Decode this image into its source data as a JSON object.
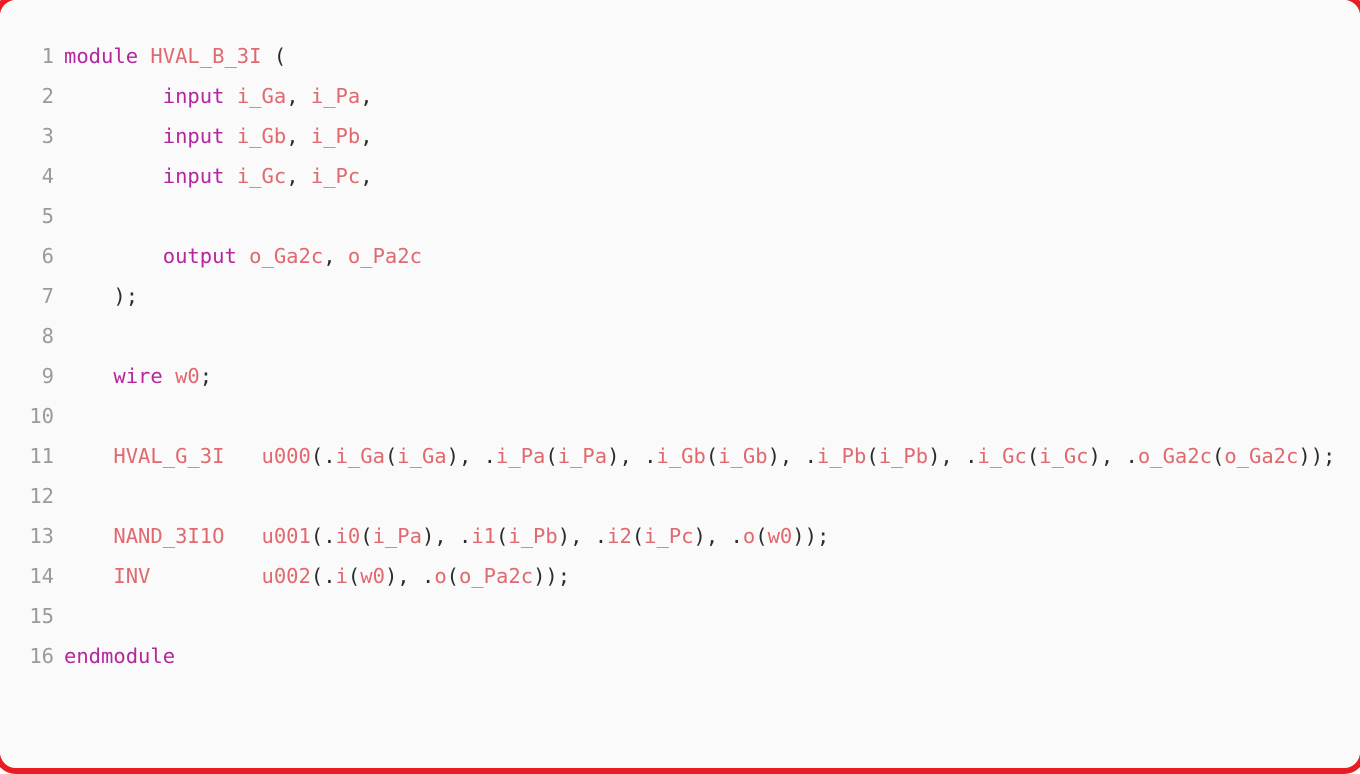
{
  "editor": {
    "language": "verilog",
    "module_name": "HVAL_B_3I",
    "total_lines": 16,
    "colors": {
      "background": "#fafafa",
      "card_border": "#e81c23",
      "line_number": "#9a9a9a",
      "keyword": "#b5269e",
      "identifier": "#e0696f",
      "punctuation": "#2b2b2b"
    }
  },
  "lines": [
    {
      "number": "1",
      "text": "module HVAL_B_3I (",
      "tokens": [
        {
          "t": "module",
          "c": "kw"
        },
        {
          "t": " ",
          "c": "pn"
        },
        {
          "t": "HVAL_B_3I",
          "c": "id"
        },
        {
          "t": " (",
          "c": "pn"
        }
      ]
    },
    {
      "number": "2",
      "text": "        input i_Ga, i_Pa,",
      "tokens": [
        {
          "t": "        ",
          "c": "pn"
        },
        {
          "t": "input",
          "c": "kw"
        },
        {
          "t": " ",
          "c": "pn"
        },
        {
          "t": "i_Ga",
          "c": "id"
        },
        {
          "t": ", ",
          "c": "pn"
        },
        {
          "t": "i_Pa",
          "c": "id"
        },
        {
          "t": ",",
          "c": "pn"
        }
      ]
    },
    {
      "number": "3",
      "text": "        input i_Gb, i_Pb,",
      "tokens": [
        {
          "t": "        ",
          "c": "pn"
        },
        {
          "t": "input",
          "c": "kw"
        },
        {
          "t": " ",
          "c": "pn"
        },
        {
          "t": "i_Gb",
          "c": "id"
        },
        {
          "t": ", ",
          "c": "pn"
        },
        {
          "t": "i_Pb",
          "c": "id"
        },
        {
          "t": ",",
          "c": "pn"
        }
      ]
    },
    {
      "number": "4",
      "text": "        input i_Gc, i_Pc,",
      "tokens": [
        {
          "t": "        ",
          "c": "pn"
        },
        {
          "t": "input",
          "c": "kw"
        },
        {
          "t": " ",
          "c": "pn"
        },
        {
          "t": "i_Gc",
          "c": "id"
        },
        {
          "t": ", ",
          "c": "pn"
        },
        {
          "t": "i_Pc",
          "c": "id"
        },
        {
          "t": ",",
          "c": "pn"
        }
      ]
    },
    {
      "number": "5",
      "text": "",
      "tokens": []
    },
    {
      "number": "6",
      "text": "        output o_Ga2c, o_Pa2c",
      "tokens": [
        {
          "t": "        ",
          "c": "pn"
        },
        {
          "t": "output",
          "c": "kw"
        },
        {
          "t": " ",
          "c": "pn"
        },
        {
          "t": "o_Ga2c",
          "c": "id"
        },
        {
          "t": ", ",
          "c": "pn"
        },
        {
          "t": "o_Pa2c",
          "c": "id"
        }
      ]
    },
    {
      "number": "7",
      "text": "    );",
      "tokens": [
        {
          "t": "    );",
          "c": "pn"
        }
      ]
    },
    {
      "number": "8",
      "text": "",
      "tokens": []
    },
    {
      "number": "9",
      "text": "    wire w0;",
      "tokens": [
        {
          "t": "    ",
          "c": "pn"
        },
        {
          "t": "wire",
          "c": "kw"
        },
        {
          "t": " ",
          "c": "pn"
        },
        {
          "t": "w0",
          "c": "id"
        },
        {
          "t": ";",
          "c": "pn"
        }
      ]
    },
    {
      "number": "10",
      "text": "",
      "tokens": []
    },
    {
      "number": "11",
      "text": "    HVAL_G_3I   u000(.i_Ga(i_Ga), .i_Pa(i_Pa), .i_Gb(i_Gb), .i_Pb(i_Pb), .i_Gc(i_Gc), .o_Ga2c(o_Ga2c));",
      "tokens": [
        {
          "t": "    ",
          "c": "pn"
        },
        {
          "t": "HVAL_G_3I",
          "c": "id"
        },
        {
          "t": "   ",
          "c": "pn"
        },
        {
          "t": "u000",
          "c": "id"
        },
        {
          "t": "(.",
          "c": "pn"
        },
        {
          "t": "i_Ga",
          "c": "id"
        },
        {
          "t": "(",
          "c": "pn"
        },
        {
          "t": "i_Ga",
          "c": "id"
        },
        {
          "t": "), .",
          "c": "pn"
        },
        {
          "t": "i_Pa",
          "c": "id"
        },
        {
          "t": "(",
          "c": "pn"
        },
        {
          "t": "i_Pa",
          "c": "id"
        },
        {
          "t": "), .",
          "c": "pn"
        },
        {
          "t": "i_Gb",
          "c": "id"
        },
        {
          "t": "(",
          "c": "pn"
        },
        {
          "t": "i_Gb",
          "c": "id"
        },
        {
          "t": "), .",
          "c": "pn"
        },
        {
          "t": "i_Pb",
          "c": "id"
        },
        {
          "t": "(",
          "c": "pn"
        },
        {
          "t": "i_Pb",
          "c": "id"
        },
        {
          "t": "), .",
          "c": "pn"
        },
        {
          "t": "i_Gc",
          "c": "id"
        },
        {
          "t": "(",
          "c": "pn"
        },
        {
          "t": "i_Gc",
          "c": "id"
        },
        {
          "t": "), .",
          "c": "pn"
        },
        {
          "t": "o_Ga2c",
          "c": "id"
        },
        {
          "t": "(",
          "c": "pn"
        },
        {
          "t": "o_Ga2c",
          "c": "id"
        },
        {
          "t": "));",
          "c": "pn"
        }
      ]
    },
    {
      "number": "12",
      "text": "",
      "tokens": []
    },
    {
      "number": "13",
      "text": "    NAND_3I1O   u001(.i0(i_Pa), .i1(i_Pb), .i2(i_Pc), .o(w0));",
      "tokens": [
        {
          "t": "    ",
          "c": "pn"
        },
        {
          "t": "NAND_3I1O",
          "c": "id"
        },
        {
          "t": "   ",
          "c": "pn"
        },
        {
          "t": "u001",
          "c": "id"
        },
        {
          "t": "(.",
          "c": "pn"
        },
        {
          "t": "i0",
          "c": "id"
        },
        {
          "t": "(",
          "c": "pn"
        },
        {
          "t": "i_Pa",
          "c": "id"
        },
        {
          "t": "), .",
          "c": "pn"
        },
        {
          "t": "i1",
          "c": "id"
        },
        {
          "t": "(",
          "c": "pn"
        },
        {
          "t": "i_Pb",
          "c": "id"
        },
        {
          "t": "), .",
          "c": "pn"
        },
        {
          "t": "i2",
          "c": "id"
        },
        {
          "t": "(",
          "c": "pn"
        },
        {
          "t": "i_Pc",
          "c": "id"
        },
        {
          "t": "), .",
          "c": "pn"
        },
        {
          "t": "o",
          "c": "id"
        },
        {
          "t": "(",
          "c": "pn"
        },
        {
          "t": "w0",
          "c": "id"
        },
        {
          "t": "));",
          "c": "pn"
        }
      ]
    },
    {
      "number": "14",
      "text": "    INV         u002(.i(w0), .o(o_Pa2c));",
      "tokens": [
        {
          "t": "    ",
          "c": "pn"
        },
        {
          "t": "INV",
          "c": "id"
        },
        {
          "t": "         ",
          "c": "pn"
        },
        {
          "t": "u002",
          "c": "id"
        },
        {
          "t": "(.",
          "c": "pn"
        },
        {
          "t": "i",
          "c": "id"
        },
        {
          "t": "(",
          "c": "pn"
        },
        {
          "t": "w0",
          "c": "id"
        },
        {
          "t": "), .",
          "c": "pn"
        },
        {
          "t": "o",
          "c": "id"
        },
        {
          "t": "(",
          "c": "pn"
        },
        {
          "t": "o_Pa2c",
          "c": "id"
        },
        {
          "t": "));",
          "c": "pn"
        }
      ]
    },
    {
      "number": "15",
      "text": "",
      "tokens": []
    },
    {
      "number": "16",
      "text": "endmodule",
      "tokens": [
        {
          "t": "endmodule",
          "c": "kw"
        }
      ]
    }
  ]
}
